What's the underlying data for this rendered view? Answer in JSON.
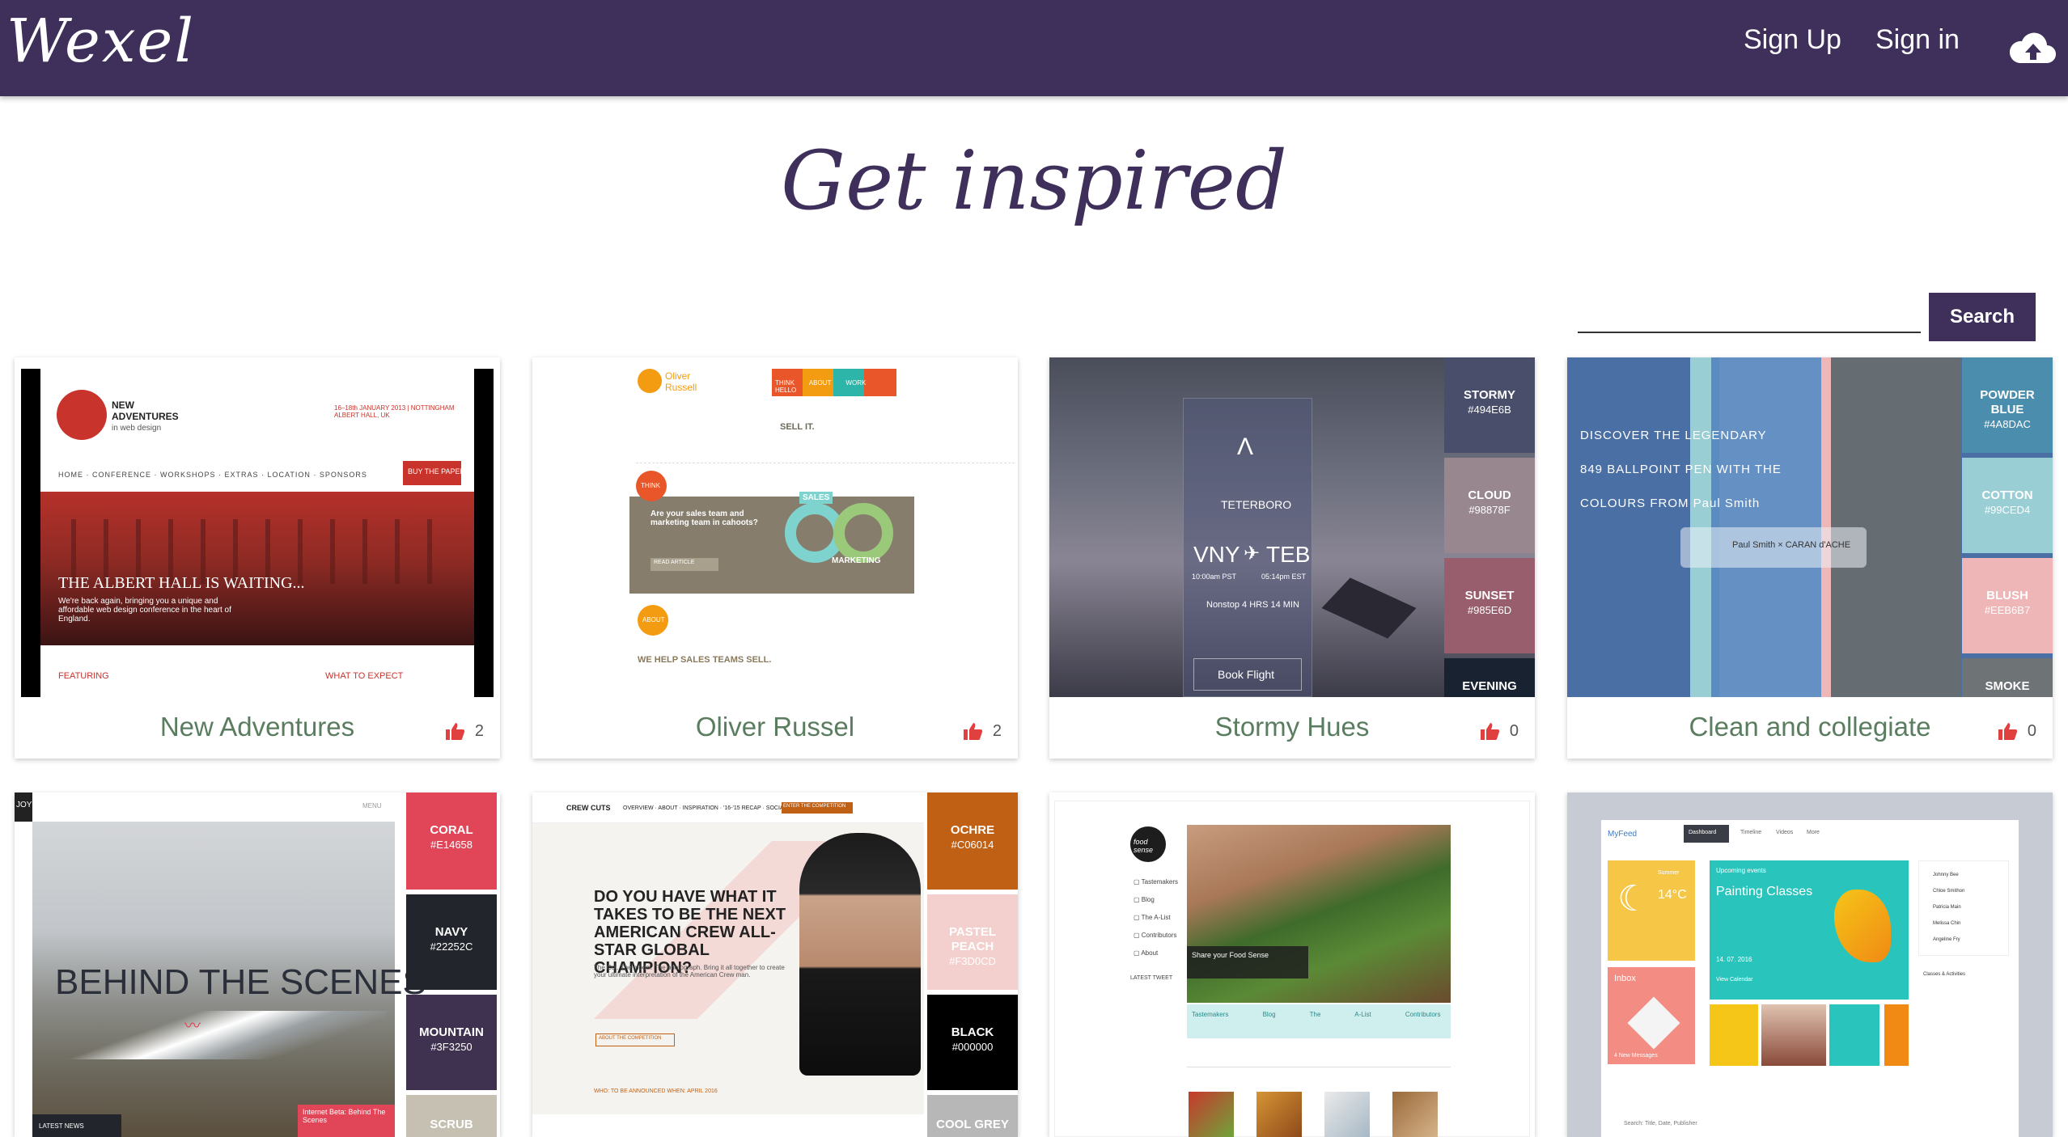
{
  "nav": {
    "brand": "Wexel",
    "signup": "Sign Up",
    "signin": "Sign in",
    "upload_icon": "cloud-upload-icon"
  },
  "hero": {
    "title": "Get inspired"
  },
  "search": {
    "value": "",
    "button": "Search"
  },
  "colors": {
    "primary": "#3e2f5b",
    "title_green": "#5a7d60",
    "like_red": "#e0413f"
  },
  "cards": [
    {
      "title": "New Adventures",
      "likes": "2",
      "thumb": {
        "brand": "NEW ADVENTURES",
        "brand_sub": "in web design",
        "date": "16–18th JANUARY 2013 | NOTTINGHAM ALBERT HALL, UK",
        "menu": [
          "HOME",
          "CONFERENCE",
          "WORKSHOPS",
          "EXTRAS",
          "LOCATION",
          "SPONSORS"
        ],
        "buy": "BUY THE PAPER",
        "headline": "THE ALBERT HALL IS WAITING...",
        "body": "We're back again, bringing you a unique and affordable web design conference in the heart of England.",
        "featuring": "FEATURING",
        "expect": "WHAT TO EXPECT"
      }
    },
    {
      "title": "Oliver Russel",
      "likes": "2",
      "thumb": {
        "brand": "Oliver Russell",
        "tabs": [
          "THINK",
          "ABOUT",
          "WORK",
          "HELLO"
        ],
        "sell": "SELL IT.",
        "think": "THINK",
        "question": "Are your sales team and marketing team in cahoots?",
        "read": "READ ARTICLE",
        "sales": "SALES",
        "marketing": "MARKETING",
        "about": "ABOUT",
        "we_help": "WE HELP SALES TEAMS SELL."
      }
    },
    {
      "title": "Stormy Hues",
      "likes": "0",
      "thumb": {
        "from": "VNY",
        "to": "TEB",
        "city": "TETERBORO",
        "dep": "10:00am PST",
        "arr": "05:14pm EST",
        "nonstop": "Nonstop  4 HRS 14 MIN",
        "book": "Book Flight",
        "swatches": [
          {
            "name": "STORMY",
            "hex": "#494E6B"
          },
          {
            "name": "CLOUD",
            "hex": "#98878F"
          },
          {
            "name": "SUNSET",
            "hex": "#985E6D"
          },
          {
            "name": "EVENING",
            "hex": ""
          }
        ]
      }
    },
    {
      "title": "Clean and collegiate",
      "likes": "0",
      "thumb": {
        "lines": [
          "DISCOVER THE LEGENDARY",
          "849 BALLPOINT PEN WITH THE",
          "COLOURS FROM Paul Smith"
        ],
        "swatches": [
          {
            "name": "POWDER BLUE",
            "hex": "#4A8DAC"
          },
          {
            "name": "COTTON",
            "hex": "#99CED4"
          },
          {
            "name": "BLUSH",
            "hex": "#EEB6B7"
          },
          {
            "name": "SMOKE",
            "hex": ""
          }
        ]
      }
    },
    {
      "title": "",
      "likes": "",
      "thumb": {
        "logo": "JOY",
        "menu": "MENU",
        "headline": "BEHIND THE SCENES",
        "latest": "LATEST NEWS",
        "beta": "Internet Beta: Behind The Scenes",
        "swatches": [
          {
            "name": "CORAL",
            "hex": "#E14658"
          },
          {
            "name": "NAVY",
            "hex": "#22252C"
          },
          {
            "name": "MOUNTAIN",
            "hex": "#3F3250"
          },
          {
            "name": "SCRUB",
            "hex": ""
          }
        ]
      }
    },
    {
      "title": "",
      "likes": "",
      "thumb": {
        "brand": "CREW CUTS",
        "menu": [
          "OVERVIEW",
          "ABOUT",
          "INSPIRATION",
          "'16-'15 RECAP",
          "SOCIAL BUZZ"
        ],
        "enter": "ENTER THE COMPETITION",
        "headline": "DO YOU HAVE WHAT IT TAKES TO BE THE NEXT AMERICAN CREW ALL- STAR GLOBAL CHAMPION?",
        "body": "The Cut. The model. The photograph. Bring it all together to create your ultimate interpretation of the American Crew man.",
        "about": "ABOUT THE COMPETITION",
        "footer": "WHO: TO BE ANNOUNCED  WHEN: APRIL 2016",
        "swatches": [
          {
            "name": "OCHRE",
            "hex": "#C06014"
          },
          {
            "name": "PASTEL PEACH",
            "hex": "#F3D0CD"
          },
          {
            "name": "BLACK",
            "hex": "#000000"
          },
          {
            "name": "COOL GREY",
            "hex": ""
          }
        ]
      }
    },
    {
      "title": "",
      "likes": "",
      "thumb": {
        "logo": "food sense",
        "side": [
          "Tastemakers",
          "Blog",
          "The A-List",
          "Contributors",
          "About"
        ],
        "latest": "LATEST TWEET",
        "caption": "Share your Food Sense",
        "tabs": [
          "Tastemakers",
          "Blog",
          "The A-List",
          "Contributors"
        ]
      }
    },
    {
      "title": "",
      "likes": "",
      "thumb": {
        "brand": "MyFeed",
        "tabs": [
          "Dashboard",
          "Timeline",
          "Videos",
          "More"
        ],
        "temp": "14°C",
        "weather": "Summer",
        "events": "Upcoming events",
        "classes": "Painting Classes",
        "date": "14. 07. 2016",
        "calendar": "View Calendar",
        "inbox": "Inbox",
        "new_messages": "4 New Messages",
        "people": [
          "Johnny Bee",
          "Chloe Smithon",
          "Patricia Main",
          "Melissa Chin",
          "Angeline Fry"
        ],
        "activities": "Classes & Activities",
        "search": "Search: Title, Date, Publisher"
      }
    }
  ]
}
